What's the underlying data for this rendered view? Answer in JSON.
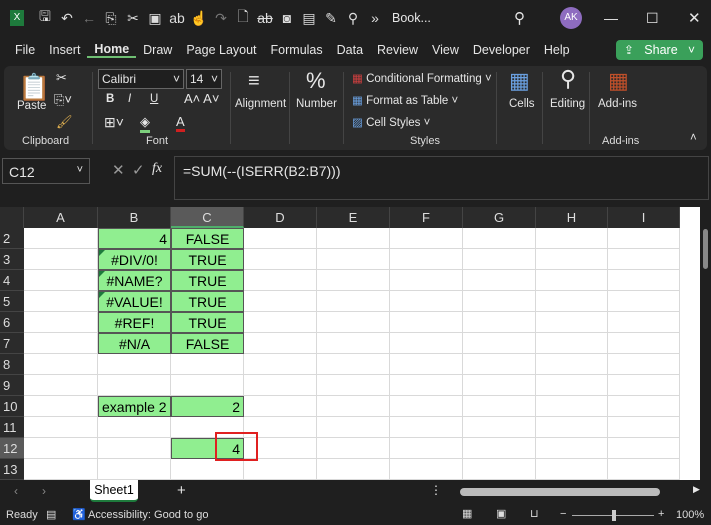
{
  "titlebar": {
    "title": "Book...",
    "avatar": "AK",
    "icons": [
      "excel-icon",
      "save-icon",
      "undo-icon",
      "back-icon",
      "copy-icon",
      "cut-icon",
      "image-icon",
      "spelling-icon",
      "touch-icon",
      "redo-icon",
      "new-icon",
      "strikethrough-icon",
      "camera-icon",
      "form-icon",
      "edit-icon",
      "find-icon",
      "more-icon"
    ]
  },
  "menu": {
    "items": [
      "File",
      "Insert",
      "Home",
      "Draw",
      "Page Layout",
      "Formulas",
      "Data",
      "Review",
      "View",
      "Developer",
      "Help"
    ],
    "active": "Home",
    "share": "Share"
  },
  "ribbon": {
    "paste": "Paste",
    "clipboard": "Clipboard",
    "font_name": "Calibri",
    "font_size": "14",
    "bold": "B",
    "italic": "I",
    "underline": "U",
    "font_group": "Font",
    "alignment": "Alignment",
    "number": "Number",
    "conditional": "Conditional Formatting",
    "format_table": "Format as Table",
    "cell_styles": "Cell Styles",
    "styles": "Styles",
    "cells": "Cells",
    "editing": "Editing",
    "addins": "Add-ins",
    "addins_group": "Add-ins"
  },
  "formula": {
    "name_box": "C12",
    "fx": "fx",
    "formula": "=SUM(--(ISERR(B2:B7)))"
  },
  "columns": [
    "A",
    "B",
    "C",
    "D",
    "E",
    "F",
    "G",
    "H",
    "I"
  ],
  "rows": [
    "2",
    "3",
    "4",
    "5",
    "6",
    "7",
    "8",
    "9",
    "10",
    "11",
    "12",
    "13"
  ],
  "cells": {
    "B2": "4",
    "C2": "FALSE",
    "B3": "#DIV/0!",
    "C3": "TRUE",
    "B4": "#NAME?",
    "C4": "TRUE",
    "B5": "#VALUE!",
    "C5": "TRUE",
    "B6": "#REF!",
    "C6": "TRUE",
    "B7": "#N/A",
    "C7": "FALSE",
    "B10": "example 2",
    "C10": "2",
    "C12": "4"
  },
  "colors": {
    "cell_fill": "#90ee90",
    "highlight": "#e02020",
    "share": "#3aa05a"
  },
  "sheets": {
    "tabs": [
      "Sheet1"
    ],
    "active": "Sheet1",
    "add": "+"
  },
  "status": {
    "ready": "Ready",
    "accessibility": "Accessibility: Good to go",
    "zoom": "100%"
  }
}
